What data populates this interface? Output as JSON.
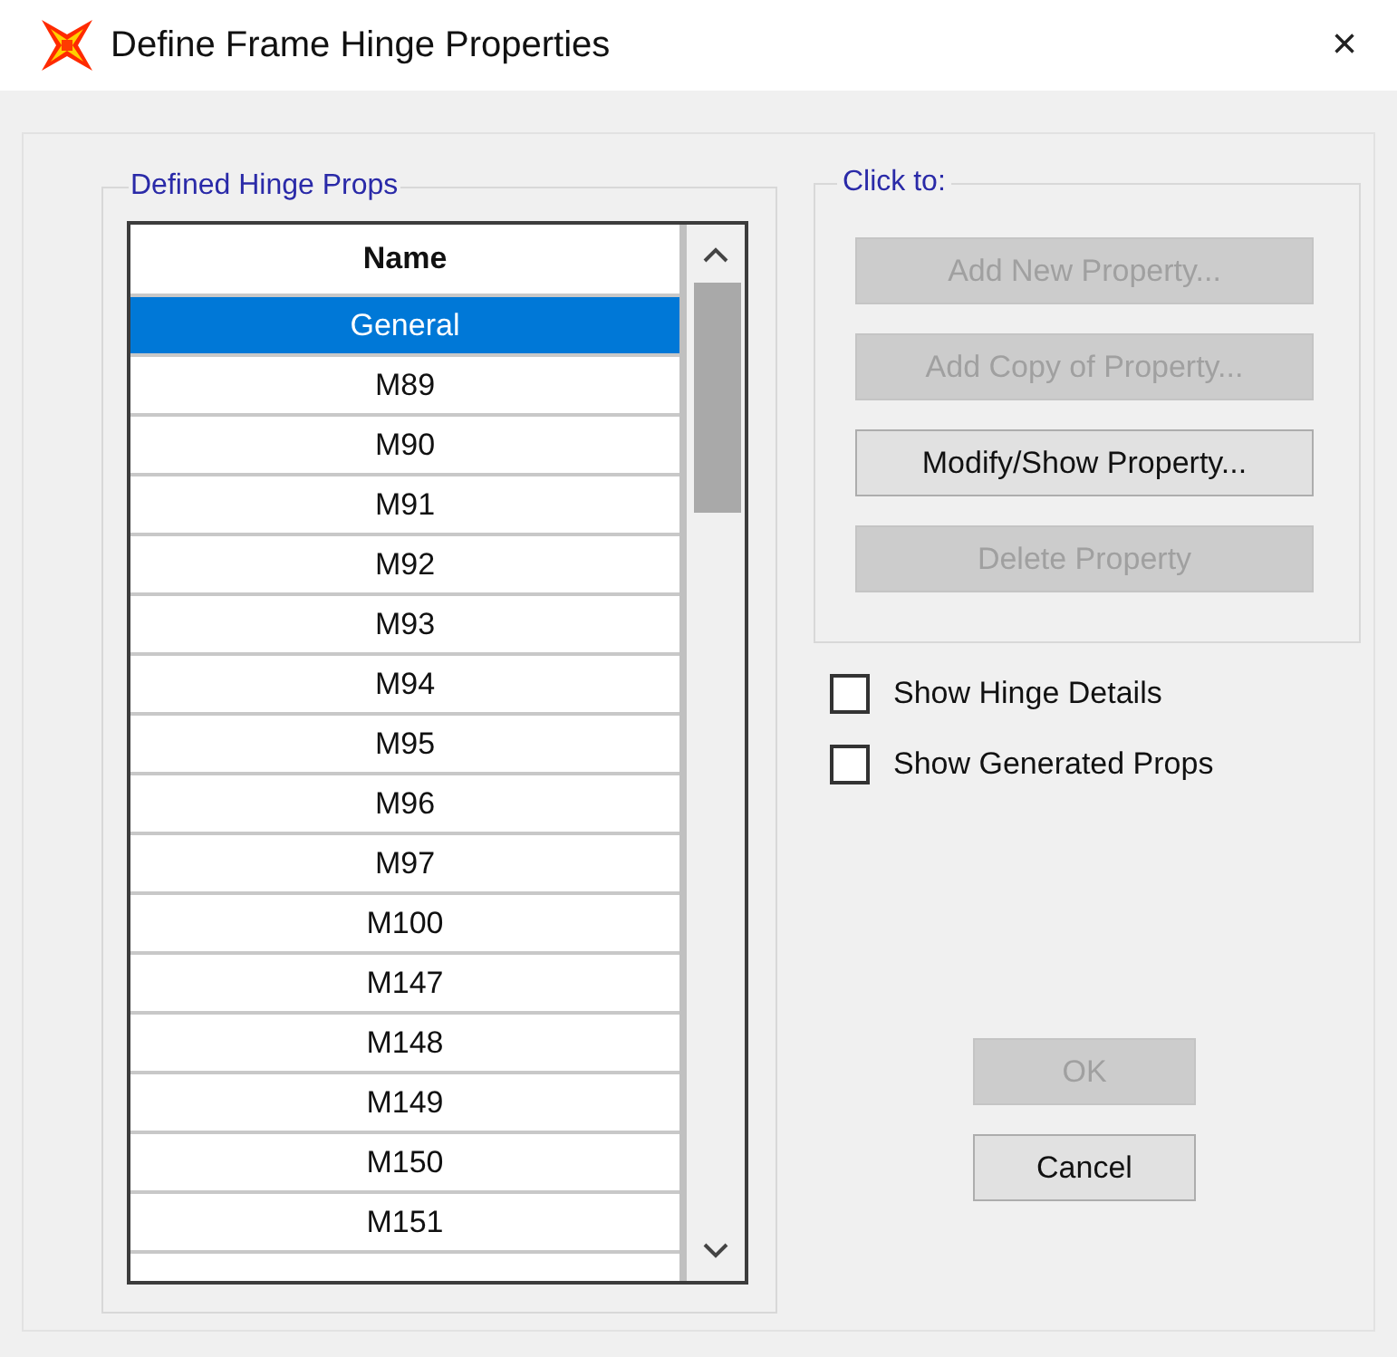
{
  "window": {
    "title": "Define Frame Hinge Properties",
    "close": "×"
  },
  "hinge_list": {
    "legend": "Defined Hinge Props",
    "column": "Name",
    "rows": [
      {
        "name": "General",
        "selected": true
      },
      {
        "name": "M89",
        "selected": false
      },
      {
        "name": "M90",
        "selected": false
      },
      {
        "name": "M91",
        "selected": false
      },
      {
        "name": "M92",
        "selected": false
      },
      {
        "name": "M93",
        "selected": false
      },
      {
        "name": "M94",
        "selected": false
      },
      {
        "name": "M95",
        "selected": false
      },
      {
        "name": "M96",
        "selected": false
      },
      {
        "name": "M97",
        "selected": false
      },
      {
        "name": "M100",
        "selected": false
      },
      {
        "name": "M147",
        "selected": false
      },
      {
        "name": "M148",
        "selected": false
      },
      {
        "name": "M149",
        "selected": false
      },
      {
        "name": "M150",
        "selected": false
      },
      {
        "name": "M151",
        "selected": false
      }
    ]
  },
  "actions": {
    "legend": "Click to:",
    "buttons": [
      {
        "label": "Add New Property...",
        "disabled": true
      },
      {
        "label": "Add Copy of Property...",
        "disabled": true
      },
      {
        "label": "Modify/Show Property...",
        "disabled": false
      },
      {
        "label": "Delete Property",
        "disabled": true
      }
    ]
  },
  "options": [
    {
      "label": "Show Hinge Details",
      "checked": false
    },
    {
      "label": "Show Generated Props",
      "checked": false
    }
  ],
  "dialog_buttons": [
    {
      "label": "OK",
      "disabled": true
    },
    {
      "label": "Cancel",
      "disabled": false
    }
  ]
}
